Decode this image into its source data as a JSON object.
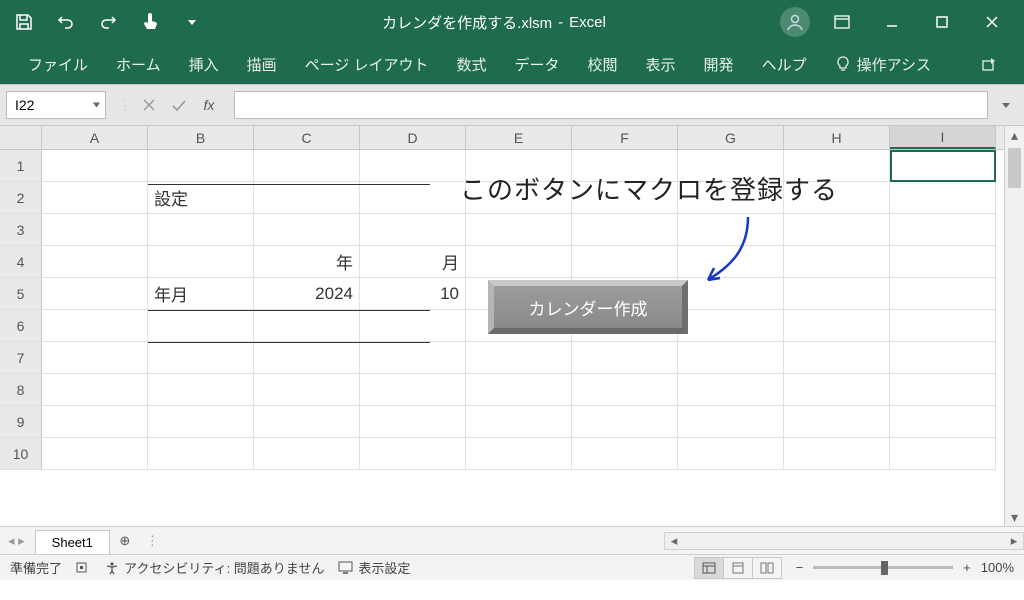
{
  "title": {
    "filename": "カレンダを作成する.xlsm",
    "app": "Excel"
  },
  "ribbon_tabs": [
    "ファイル",
    "ホーム",
    "挿入",
    "描画",
    "ページ レイアウト",
    "数式",
    "データ",
    "校閲",
    "表示",
    "開発",
    "ヘルプ"
  ],
  "tellme_placeholder": "操作アシス",
  "namebox": "I22",
  "columns": [
    "A",
    "B",
    "C",
    "D",
    "E",
    "F",
    "G",
    "H",
    "I"
  ],
  "row_numbers": [
    1,
    2,
    3,
    4,
    5,
    6,
    7,
    8,
    9,
    10
  ],
  "cells": {
    "b2": "設定",
    "c4": "年",
    "d4": "月",
    "b5": "年月",
    "c5": "2024",
    "d5": "10"
  },
  "macro_button_label": "カレンダー作成",
  "annotation_text": "このボタンにマクロを登録する",
  "sheet_tab": "Sheet1",
  "status": {
    "ready": "準備完了",
    "accessibility": "アクセシビリティ: 問題ありません",
    "display_settings": "表示設定",
    "zoom": "100%"
  }
}
